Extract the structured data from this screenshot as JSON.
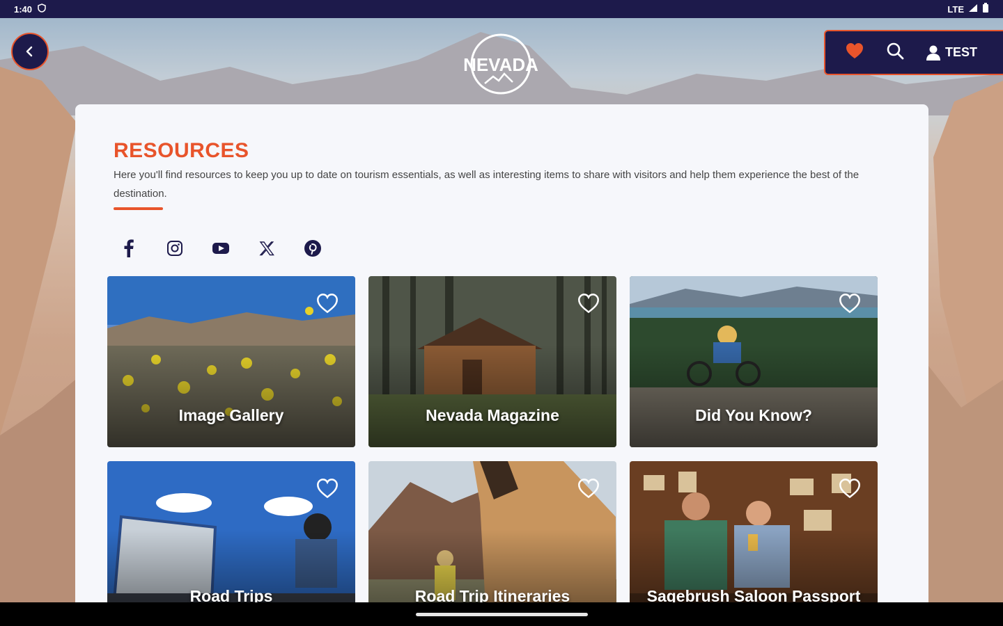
{
  "status_bar": {
    "time": "1:40",
    "network": "LTE"
  },
  "header": {
    "back_icon": "chevron-left-icon",
    "logo_text": "NEVADA",
    "toolbar": {
      "favorites_icon": "heart-icon",
      "search_icon": "search-icon",
      "account_icon": "user-icon",
      "account_label": "TEST"
    }
  },
  "resources": {
    "title": "RESOURCES",
    "description": "Here you'll find resources to keep you up to date on tourism essentials, as well as interesting items to share with visitors and help them experience the best of the destination."
  },
  "social": [
    "facebook-icon",
    "instagram-icon",
    "youtube-icon",
    "x-icon",
    "pinterest-icon"
  ],
  "tiles": [
    {
      "label": "Image Gallery"
    },
    {
      "label": "Nevada Magazine"
    },
    {
      "label": "Did You Know?"
    },
    {
      "label": "Road Trips"
    },
    {
      "label": "Road Trip Itineraries"
    },
    {
      "label": "Sagebrush Saloon Passport"
    }
  ],
  "colors": {
    "navy": "#1d1a4b",
    "accent": "#e8542b"
  }
}
